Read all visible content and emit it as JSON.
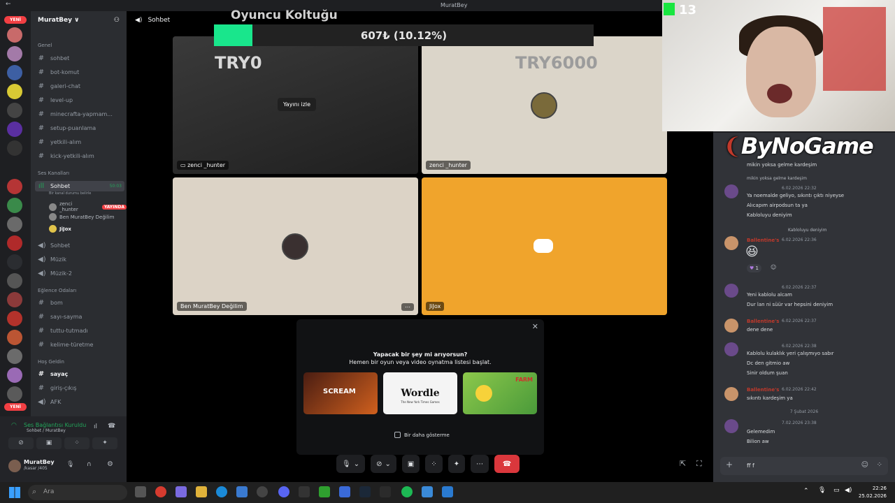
{
  "window": {
    "title": "MuratBey"
  },
  "server_badges": [
    "YENİ",
    "YENİ"
  ],
  "guild": {
    "name": "MuratBey ∨"
  },
  "categories": {
    "genel": "Genel",
    "voice": "Ses Kanalları",
    "fun": "Eğlence Odaları",
    "welcome": "Hoş Geldin"
  },
  "text_channels": [
    "sohbet",
    "bot-komut",
    "galeri-chat",
    "level-up",
    "minecrafta-yapmam...",
    "setup-puanlama",
    "yetkili-alım",
    "kick-yetkili-alım"
  ],
  "voice_channel": {
    "name": "Sohbet",
    "timer": "50:03",
    "status": "Bir kanal durumu belirle"
  },
  "voice_users": [
    {
      "name": "zenci _hunter",
      "live": "YAYINDA"
    },
    {
      "name": "Ben MuratBey Değilim",
      "live": ""
    },
    {
      "name": "JiJox",
      "live": ""
    }
  ],
  "other_voice": [
    "Sohbet",
    "Müzik",
    "Müzik-2"
  ],
  "fun_channels": [
    "bom",
    "sayı-sayma",
    "tuttu-tutmadı",
    "kelime-türetme"
  ],
  "welcome_channels": [
    "sayaç",
    "giriş-çıkış",
    "AFK"
  ],
  "user_panel": {
    "connection": "Ses Bağlantısı Kuruldu",
    "connection_sub": "Sohbet / MuratBey",
    "username": "MuratBey",
    "tag": "/kasar /405"
  },
  "stage": {
    "header": "Sohbet",
    "watch_label": "Yayını izle",
    "tiles": [
      {
        "label": "zenci _hunter"
      },
      {
        "label": "zenci _hunter"
      },
      {
        "label": "Ben MuratBey Değilim"
      },
      {
        "label": "JiJox"
      }
    ]
  },
  "overlay": {
    "title": "Oyuncu Koltuğu",
    "value": "607₺ (10.12%)",
    "progress": 0.1012,
    "left_target": "TRY0",
    "right_target": "TRY6000"
  },
  "activity": {
    "line1": "Yapacak bir şey mi arıyorsun?",
    "line2": "Hemen bir oyun veya video oynatma listesi başlat.",
    "games": [
      "SCREAM",
      "Wordle",
      "FARM"
    ],
    "wordle_sub": "The New York Times Games",
    "dont_show": "Bir daha gösterme"
  },
  "stream_overlay": {
    "counter": "13",
    "logo": "ByNoGame"
  },
  "chat": {
    "date_divider": "7 Şubat 2026",
    "input": "ff f",
    "messages": [
      {
        "lines": [
          "mikin yoksa gelme kardeşim"
        ],
        "time": "",
        "name": ""
      },
      {
        "reply": "mikin yoksa gelme kardeşim",
        "time": "6.02.2026 22:32",
        "lines": [
          "Ya noemalde geliyo, sıkıntı çıktı niyeyse",
          "Alıcapım airpodsun ta ya",
          "Kabloluyu deniyim"
        ]
      },
      {
        "reply": "Kabloluyu deniyim",
        "name": "Ballentine's",
        "time": "6.02.2026 22:36",
        "lines": [],
        "reaction": "1"
      },
      {
        "time": "6.02.2026 22:37",
        "lines": [
          "Yeni kablolu alcam",
          "Dur lan ni süür var hepsini deniyim"
        ]
      },
      {
        "name": "Ballentine's",
        "time": "6.02.2026 22:37",
        "lines": [
          "dene dene"
        ]
      },
      {
        "time": "6.02.2026 22:38",
        "lines": [
          "Kablolu kulaklık yeri çalışmıyo sabır",
          "Dc den gitmio aw",
          "Sinir oldum şuan"
        ]
      },
      {
        "name": "Ballentine's",
        "time": "6.02.2026 22:42",
        "lines": [
          "sıkıntı kardeşim ya"
        ]
      },
      {
        "time": "7.02.2026 23:38",
        "lines": [
          "Gelemedim",
          "Bilion aw"
        ]
      }
    ]
  },
  "taskbar": {
    "search": "Ara",
    "time": "22:26",
    "date": "25.02.2026"
  }
}
